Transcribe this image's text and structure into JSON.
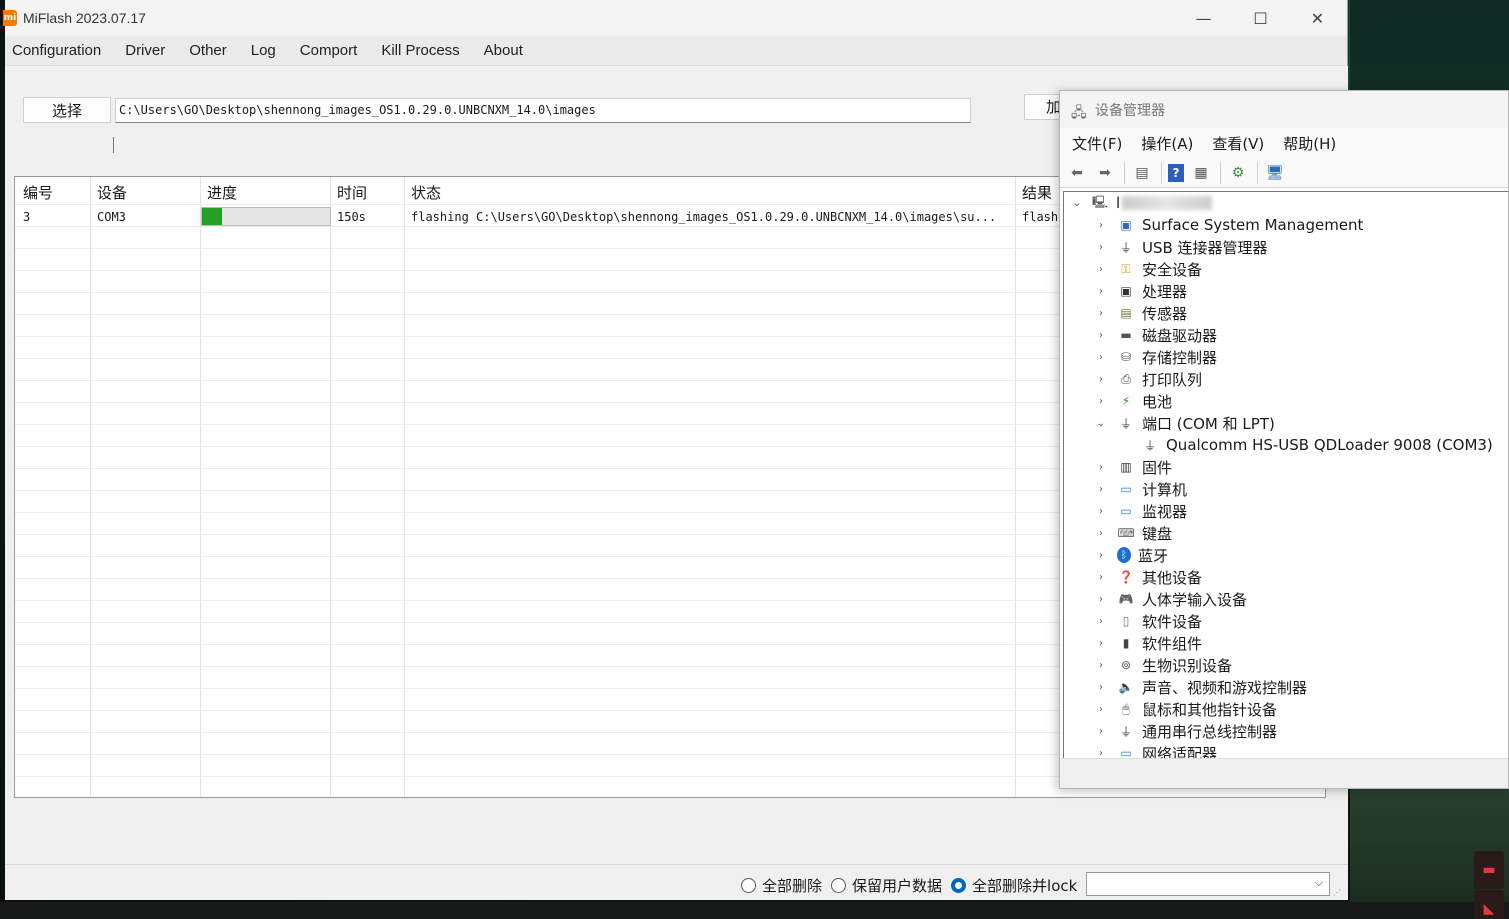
{
  "miflash": {
    "app_icon_text": "mi",
    "title": "MiFlash 2023.07.17",
    "window_controls": {
      "minimize": "—",
      "maximize": "☐",
      "close": "✕"
    },
    "menu": [
      "Configuration",
      "Driver",
      "Other",
      "Log",
      "Comport",
      "Kill Process",
      "About"
    ],
    "select_button": "选择",
    "path_value": "C:\\Users\\GO\\Desktop\\shennong_images_OS1.0.29.0.UNBCNXM_14.0\\images",
    "load_button": "加",
    "table": {
      "headers": [
        "编号",
        "设备",
        "进度",
        "时间",
        "状态",
        "结果"
      ],
      "rows": [
        {
          "id": "3",
          "device": "COM3",
          "progress": 0.16,
          "time": "150s",
          "status": "flashing C:\\Users\\GO\\Desktop\\shennong_images_OS1.0.29.0.UNBCNXM_14.0\\images\\su...",
          "result": "flash"
        }
      ]
    },
    "flash_options": [
      {
        "label": "全部删除",
        "selected": false
      },
      {
        "label": "保留用户数据",
        "selected": false
      },
      {
        "label": "全部删除并lock",
        "selected": true
      }
    ],
    "combo_value": "",
    "accent_color": "#0067c0",
    "progress_color": "#26a126"
  },
  "devmgr": {
    "title": "设备管理器",
    "menu": [
      "文件(F)",
      "操作(A)",
      "查看(V)",
      "帮助(H)"
    ],
    "toolbar_icons": [
      "back-icon",
      "forward-icon",
      "properties-icon",
      "help-icon",
      "view-icon",
      "update-driver-icon",
      "monitor-scan-icon"
    ],
    "root_label": "l",
    "tree": [
      {
        "label": "Surface System Management",
        "icon": "system-icon",
        "expanded": false
      },
      {
        "label": "USB 连接器管理器",
        "icon": "usb-icon",
        "expanded": false
      },
      {
        "label": "安全设备",
        "icon": "key-icon",
        "expanded": false
      },
      {
        "label": "处理器",
        "icon": "chip-icon",
        "expanded": false
      },
      {
        "label": "传感器",
        "icon": "sensor-icon",
        "expanded": false
      },
      {
        "label": "磁盘驱动器",
        "icon": "disk-icon",
        "expanded": false
      },
      {
        "label": "存储控制器",
        "icon": "storage-icon",
        "expanded": false
      },
      {
        "label": "打印队列",
        "icon": "printer-icon",
        "expanded": false
      },
      {
        "label": "电池",
        "icon": "battery-icon",
        "expanded": false
      },
      {
        "label": "端口 (COM 和 LPT)",
        "icon": "port-icon",
        "expanded": true,
        "children": [
          {
            "label": "Qualcomm HS-USB QDLoader 9008 (COM3)",
            "icon": "port-icon"
          }
        ]
      },
      {
        "label": "固件",
        "icon": "firmware-icon",
        "expanded": false
      },
      {
        "label": "计算机",
        "icon": "computer-icon",
        "expanded": false
      },
      {
        "label": "监视器",
        "icon": "monitor-icon",
        "expanded": false
      },
      {
        "label": "键盘",
        "icon": "keyboard-icon",
        "expanded": false
      },
      {
        "label": "蓝牙",
        "icon": "bluetooth-icon",
        "expanded": false
      },
      {
        "label": "其他设备",
        "icon": "unknown-device-icon",
        "expanded": false
      },
      {
        "label": "人体学输入设备",
        "icon": "hid-icon",
        "expanded": false
      },
      {
        "label": "软件设备",
        "icon": "software-device-icon",
        "expanded": false
      },
      {
        "label": "软件组件",
        "icon": "software-component-icon",
        "expanded": false
      },
      {
        "label": "生物识别设备",
        "icon": "fingerprint-icon",
        "expanded": false
      },
      {
        "label": "声音、视频和游戏控制器",
        "icon": "speaker-icon",
        "expanded": false
      },
      {
        "label": "鼠标和其他指针设备",
        "icon": "mouse-icon",
        "expanded": false
      },
      {
        "label": "通用串行总线控制器",
        "icon": "usb-controller-icon",
        "expanded": false
      },
      {
        "label": "网络适配器",
        "icon": "network-icon",
        "expanded": false
      }
    ]
  }
}
